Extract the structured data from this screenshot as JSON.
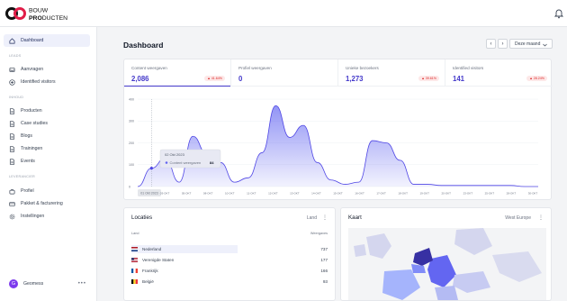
{
  "brand": {
    "line1": "BOUW",
    "line2a": "PRO",
    "line2b": "DUCTEN"
  },
  "sidebar": {
    "items": [
      {
        "label": "Dashboard",
        "icon": "home-icon",
        "active": true
      },
      {
        "label": "Aanvragen",
        "icon": "inbox-icon"
      },
      {
        "label": "Identified visitors",
        "icon": "plus-circle-icon"
      },
      {
        "label": "Producten",
        "icon": "document-icon"
      },
      {
        "label": "Case studies",
        "icon": "document-icon"
      },
      {
        "label": "Blogs",
        "icon": "document-icon"
      },
      {
        "label": "Trainingen",
        "icon": "document-icon"
      },
      {
        "label": "Events",
        "icon": "document-icon"
      },
      {
        "label": "Profiel",
        "icon": "briefcase-icon"
      },
      {
        "label": "Pakket & facturering",
        "icon": "card-icon"
      },
      {
        "label": "Instellingen",
        "icon": "gear-icon"
      }
    ],
    "sections": [
      "LEADS",
      "INHOUD",
      "LEVERANCIER"
    ],
    "user": {
      "initial": "G",
      "name": "Geomess",
      "menu": "•••"
    }
  },
  "header": {
    "title": "Dashboard",
    "prev": "‹",
    "next": "›",
    "period": "Deze maand"
  },
  "stats": [
    {
      "label": "Content weergaven",
      "value": "2,086",
      "badge": "▲ 41.64%"
    },
    {
      "label": "Profiel weergaven",
      "value": "0",
      "badge": ""
    },
    {
      "label": "Unieke bezoekers",
      "value": "1,273",
      "badge": "▲ 39.61%"
    },
    {
      "label": "Identified visitors",
      "value": "141",
      "badge": "▲ 28.24%"
    }
  ],
  "tooltip": {
    "date": "02 Okt 2023",
    "label": "Content weergaven",
    "value": "84"
  },
  "chart_data": {
    "type": "area",
    "ylabel": "",
    "ylim": [
      0,
      400
    ],
    "y_ticks": [
      "0",
      "100",
      "200",
      "300",
      "400"
    ],
    "x_ticks": [
      "01 Okt 2023",
      "03-OKT",
      "05-OKT",
      "08-OKT",
      "10-OKT",
      "11-OKT",
      "12-OKT",
      "13-OKT",
      "14-OKT",
      "15-OKT",
      "16-OKT",
      "17-OKT",
      "18-OKT",
      "19-OKT",
      "20-OKT",
      "23-OKT",
      "25-OKT",
      "28-OKT",
      "30-OKT"
    ],
    "series": [
      {
        "values": [
          0,
          84,
          130,
          20,
          230,
          150,
          110,
          20,
          40,
          155,
          370,
          225,
          280,
          110,
          30,
          10,
          20,
          210,
          200,
          120,
          10,
          10,
          5,
          5,
          5,
          5,
          5,
          5,
          0,
          0
        ]
      }
    ],
    "accent": "#6366f1"
  },
  "locations": {
    "title": "Locaties",
    "filter": "Land",
    "col_country": "Land",
    "col_views": "Weergaves",
    "rows": [
      {
        "country": "Nederland",
        "value": "737",
        "flag": "nl"
      },
      {
        "country": "Verenigde Staten",
        "value": "177",
        "flag": "us"
      },
      {
        "country": "Frankrijk",
        "value": "166",
        "flag": "fr"
      },
      {
        "country": "België",
        "value": "93",
        "flag": "be"
      }
    ]
  },
  "map": {
    "title": "Kaart",
    "region": "West Europe"
  }
}
